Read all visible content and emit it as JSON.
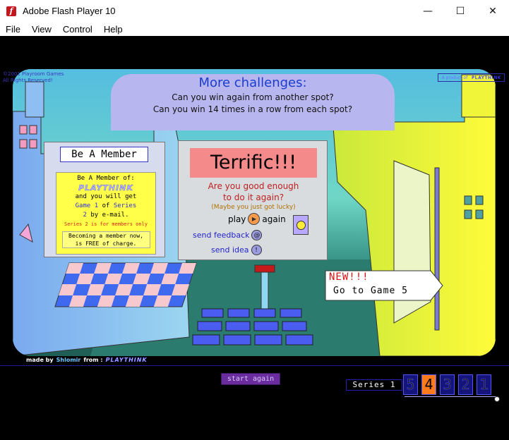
{
  "window": {
    "title": "Adobe Flash Player 10",
    "app_icon_glyph": "f",
    "minimize_glyph": "—",
    "maximize_glyph": "☐",
    "close_glyph": "✕"
  },
  "menu": [
    "File",
    "View",
    "Control",
    "Help"
  ],
  "game": {
    "copyright_line1": "©2001 Playroom Games",
    "copyright_line2": "All Rights Reserved!",
    "product_label": "A product of",
    "brand": "PLAYTHINK",
    "banner": {
      "title": "More challenges:",
      "line1": "Can you win again from another spot?",
      "line2": "Can you win 14 times in a row from each spot?"
    },
    "member": {
      "title": "Be A Member",
      "line1": "Be A Member of:",
      "brand": "PLAYTHINK",
      "line2": "and you will get",
      "game_word": "Game",
      "game_num": "1",
      "of_word": "of",
      "series_word": "Series",
      "series_num": "2",
      "by_email": "by e-mail.",
      "note": "Series 2 is for members only",
      "free_line1": "Becoming a member now,",
      "free_line2": "is FREE of charge."
    },
    "result": {
      "headline": "Terrific!!!",
      "question_line1": "Are you good enough",
      "question_line2": "to do it again?",
      "aside": "(Maybe you just got lucky)",
      "play_label": "play",
      "again_label": "again",
      "feedback_label": "send feedback",
      "idea_label": "send idea"
    },
    "next": {
      "new_label": "NEW!!!",
      "goto_label": "Go to Game 5"
    },
    "credit": {
      "made_by": "made by",
      "author": "Shlomir",
      "from": "from :",
      "brand": "PLAYTHINK"
    },
    "start_again_label": "start again",
    "series_label": "Series 1",
    "levels": [
      "5",
      "4",
      "3",
      "2",
      "1"
    ],
    "current_level": "4",
    "colors": {
      "banner": "#b8b6ee",
      "accent_blue": "#2323cc",
      "terrific_bg": "#f58a8a",
      "member_box": "#ffff4a",
      "current_level": "#ff7a1a",
      "start_button": "#6a2c9e"
    }
  }
}
